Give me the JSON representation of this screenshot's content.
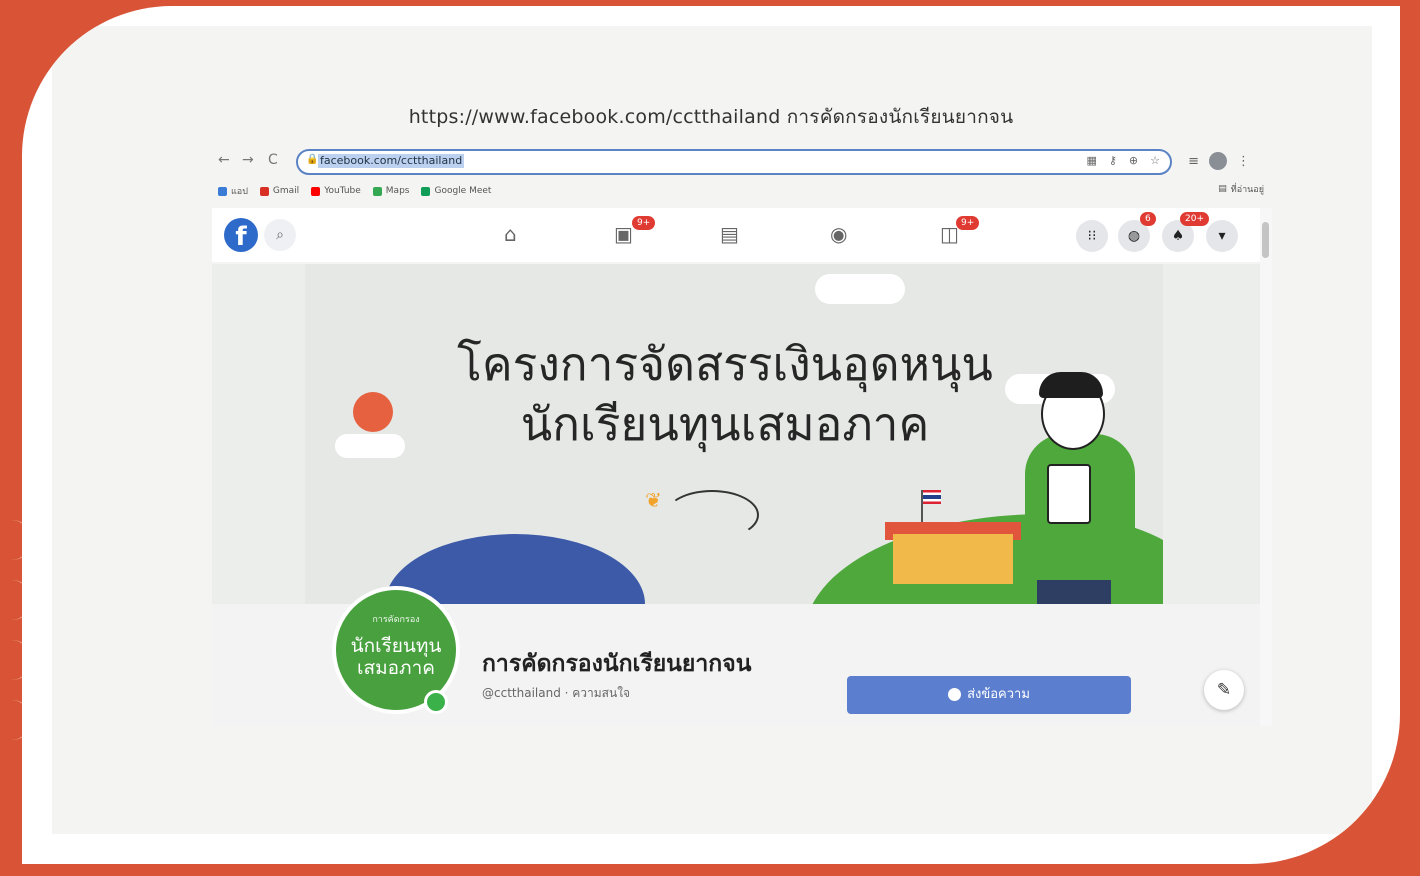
{
  "heading": "https://www.facebook.com/cctthailand การคัดกรองนักเรียนยากจน",
  "browser": {
    "url": "facebook.com/cctthailand",
    "back": "←",
    "forward": "→",
    "reload": "C",
    "bookmarks": [
      {
        "label": "แอป",
        "color": "#3a7bd5"
      },
      {
        "label": "Gmail",
        "color": "#d93025"
      },
      {
        "label": "YouTube",
        "color": "#ff0000"
      },
      {
        "label": "Maps",
        "color": "#34a853"
      },
      {
        "label": "Google Meet",
        "color": "#0f9d58"
      }
    ],
    "reading_list": "ที่อ่านอยู่"
  },
  "fb": {
    "logo": "f",
    "video_badge": "9+",
    "gaming_badge": "9+",
    "messenger_badge": "6",
    "notifications_badge": "20+"
  },
  "cover": {
    "line1": "โครงการจัดสรรเงินอุดหนุน",
    "line2": "นักเรียนทุนเสมอภาค"
  },
  "profile": {
    "avatar_line1": "การคัดกรอง",
    "avatar_line2": "นักเรียนทุน",
    "avatar_line3": "เสมอภาค",
    "page_name": "การคัดกรองนักเรียนยากจน",
    "handle": "@cctthailand · ความสนใจ",
    "message_button": "ส่งข้อความ"
  }
}
